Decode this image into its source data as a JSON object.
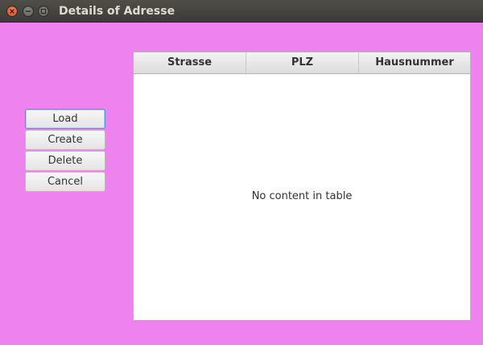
{
  "window": {
    "title": "Details of Adresse",
    "controls": [
      "close",
      "minimize",
      "maximize"
    ]
  },
  "actions": {
    "load_label": "Load",
    "create_label": "Create",
    "delete_label": "Delete",
    "cancel_label": "Cancel"
  },
  "table": {
    "columns": [
      "Strasse",
      "PLZ",
      "Hausnummer"
    ],
    "empty_message": "No content in table",
    "rows": []
  },
  "colors": {
    "background": "#ee82ee",
    "focus_accent": "#3d9be0"
  }
}
